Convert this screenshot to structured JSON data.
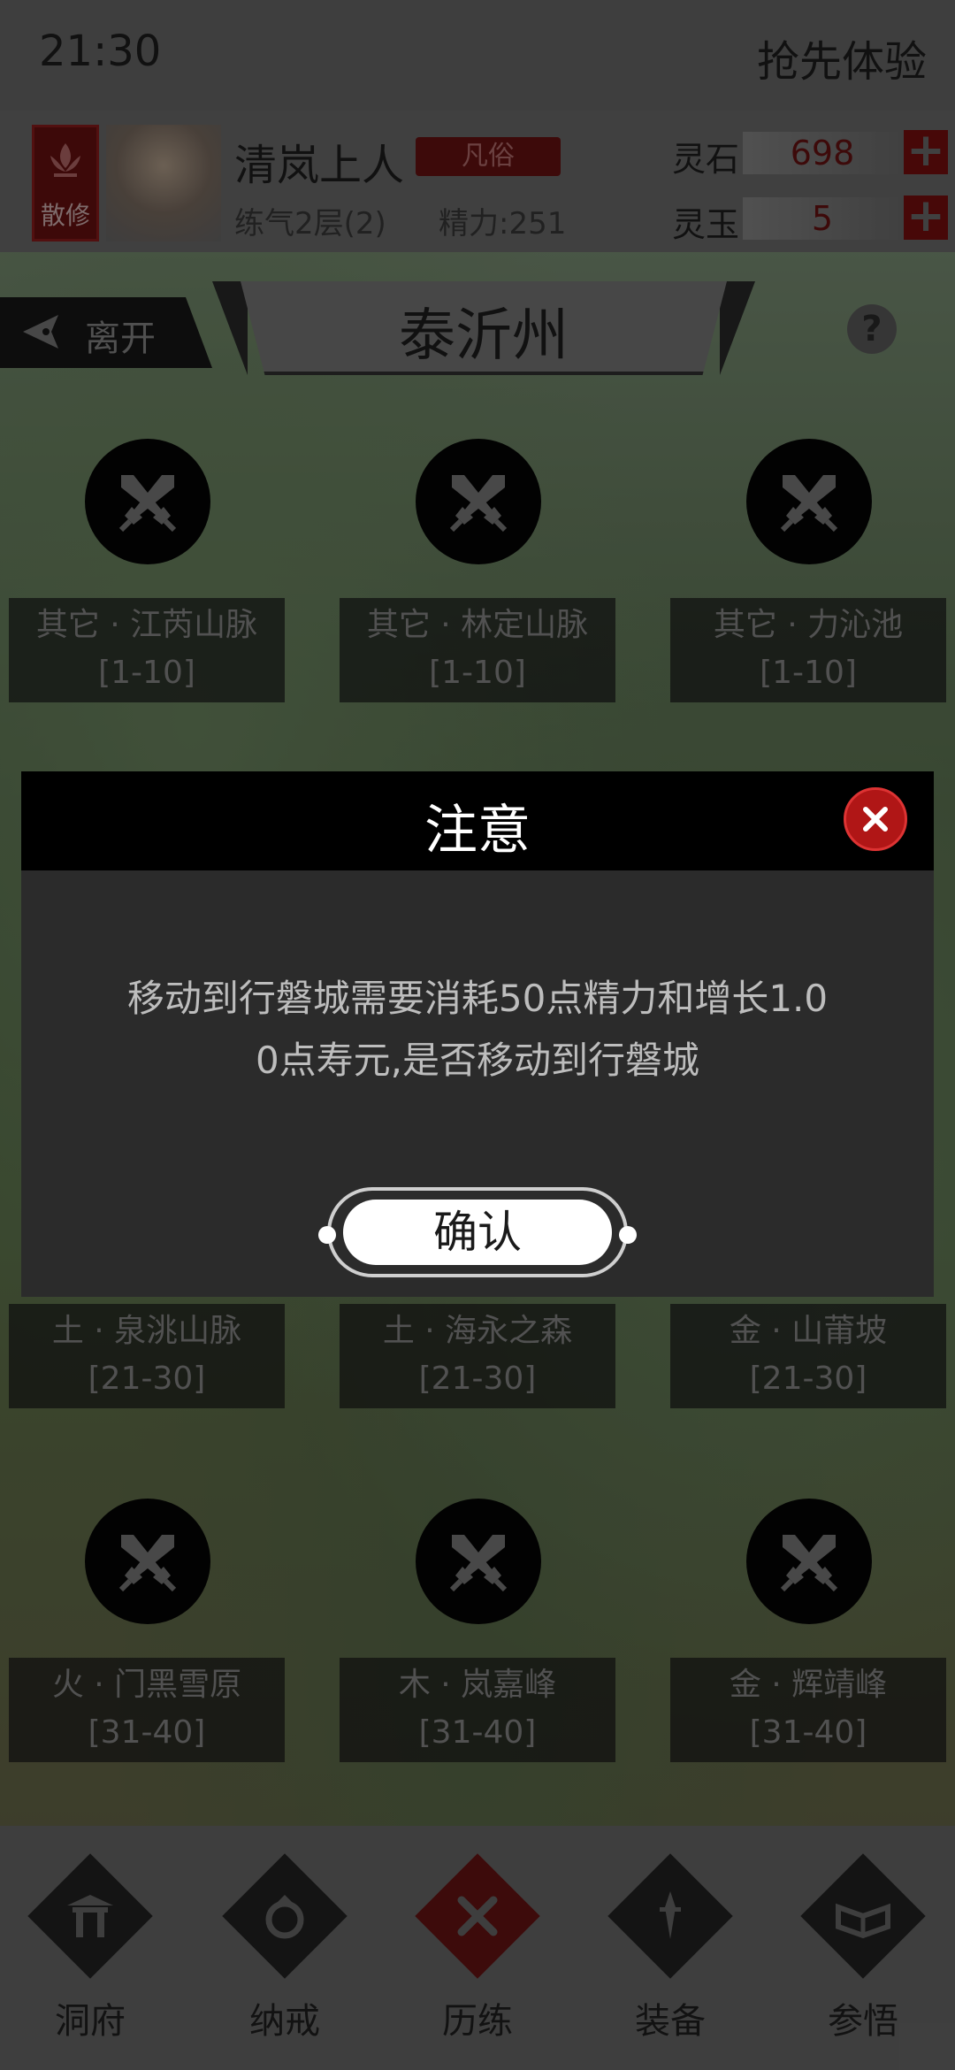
{
  "status_bar": {
    "time": "21:30",
    "right_text": "抢先体验"
  },
  "player": {
    "sect": "散修",
    "name": "清岚上人",
    "rank": "凡俗",
    "cultivation": "练气2层(2)",
    "energy": "精力:251"
  },
  "resources": [
    {
      "label": "灵石",
      "value": "698"
    },
    {
      "label": "灵玉",
      "value": "5"
    }
  ],
  "header": {
    "leave_label": "离开",
    "region_title": "泰沂州",
    "help_glyph": "?"
  },
  "locations": [
    {
      "name": "其它 · 江芮山脉",
      "level": "[1-10]"
    },
    {
      "name": "其它 · 林定山脉",
      "level": "[1-10]"
    },
    {
      "name": "其它 · 力沁池",
      "level": "[1-10]"
    },
    {
      "name": "土 · 泉洮山脉",
      "level": "[21-30]"
    },
    {
      "name": "土 · 海永之森",
      "level": "[21-30]"
    },
    {
      "name": "金 · 山莆坡",
      "level": "[21-30]"
    },
    {
      "name": "火 · 门黑雪原",
      "level": "[31-40]"
    },
    {
      "name": "木 · 岚嘉峰",
      "level": "[31-40]"
    },
    {
      "name": "金 · 辉靖峰",
      "level": "[31-40]"
    }
  ],
  "dialog": {
    "title": "注意",
    "message_line1": "移动到行磐城需要消耗50点精力和增长1.0",
    "message_line2": "0点寿元,是否移动到行磐城",
    "confirm_label": "确认"
  },
  "nav": [
    {
      "label": "洞府",
      "icon": "gate-icon"
    },
    {
      "label": "纳戒",
      "icon": "ring-icon"
    },
    {
      "label": "历练",
      "icon": "crossed-swords-icon"
    },
    {
      "label": "装备",
      "icon": "dagger-icon"
    },
    {
      "label": "参悟",
      "icon": "book-icon"
    }
  ],
  "colors": {
    "accent": "#b01616",
    "dialog_bg": "#2b2b2b",
    "dialog_header": "#000000"
  }
}
